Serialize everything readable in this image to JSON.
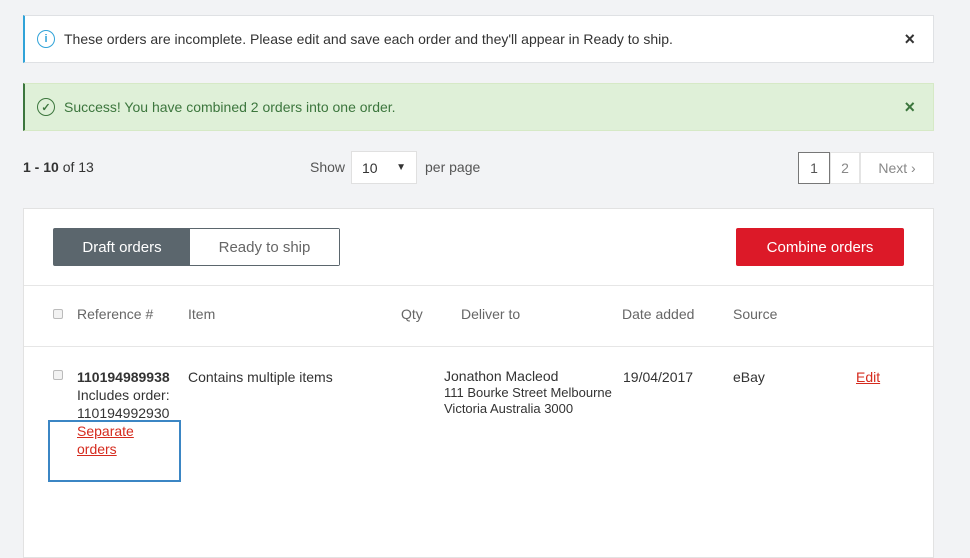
{
  "alerts": {
    "info": "These orders are incomplete. Please edit and save each order and they'll appear in Ready to ship.",
    "success": "Success! You have combined 2 orders into one order.",
    "close": "×",
    "info_icon": "i",
    "success_icon": "✓"
  },
  "pagination": {
    "range": "1 - 10",
    "of": "of 13",
    "show": "Show",
    "per_page_value": "10",
    "per_page": "per page",
    "pages": [
      "1",
      "2"
    ],
    "next": "Next ›",
    "current_page": "1"
  },
  "tabs": {
    "draft": "Draft orders",
    "ready": "Ready to ship"
  },
  "combine_label": "Combine orders",
  "table": {
    "headers": [
      "Reference #",
      "Item",
      "Qty",
      "Deliver to",
      "Date added",
      "Source"
    ],
    "rows": [
      {
        "reference": "110194989938",
        "includes_label": "Includes order:",
        "includes": "110194992930",
        "separate": "Separate orders",
        "item": "Contains multiple items",
        "qty": "",
        "name": "Jonathon Macleod",
        "address1": "111 Bourke Street Melbourne",
        "address2": "Victoria Australia 3000",
        "date": "19/04/2017",
        "source": "eBay",
        "edit": "Edit"
      }
    ]
  },
  "colors": {
    "accent": "#dc1928",
    "info": "#31a3d8",
    "success": "#3c763d",
    "tab_active": "#5b666d"
  }
}
